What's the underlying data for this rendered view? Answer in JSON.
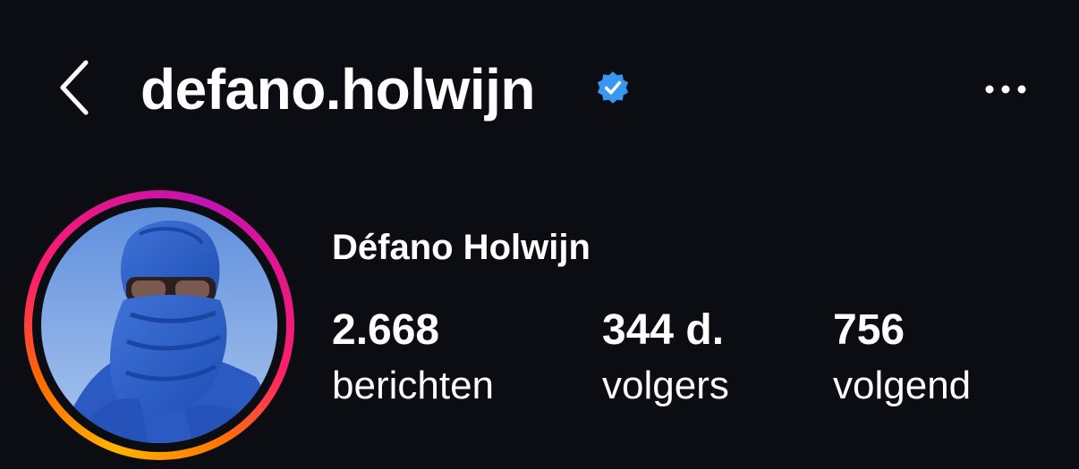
{
  "header": {
    "username": "defano.holwijn",
    "verified_color": "#3897f0",
    "icons": {
      "back": "chevron-left-icon",
      "more": "more-horizontal-icon",
      "verified": "verified-badge-icon"
    }
  },
  "profile": {
    "display_name": "Défano Holwijn",
    "story_ring_colors": [
      "#ffb400",
      "#ff1f6b",
      "#c113b7"
    ]
  },
  "stats": {
    "posts": {
      "value": "2.668",
      "label": "berichten"
    },
    "followers": {
      "value": "344 d.",
      "label": "volgers"
    },
    "following": {
      "value": "756",
      "label": "volgend"
    }
  }
}
